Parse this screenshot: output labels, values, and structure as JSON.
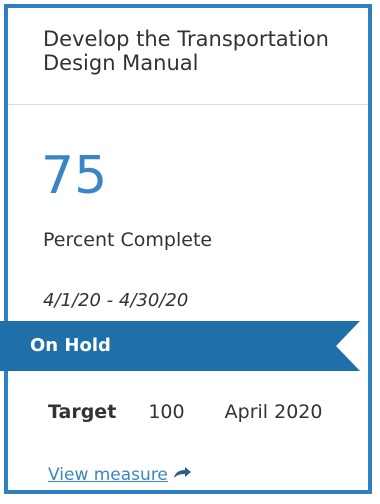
{
  "card": {
    "title": "Develop the Transportation Design Manual",
    "percent_value": "75",
    "percent_label": "Percent Complete",
    "date_range": "4/1/20 - 4/30/20",
    "status": "On Hold",
    "target": {
      "label": "Target",
      "value": "100",
      "date": "April 2020"
    },
    "link_label": "View measure",
    "link_icon": "share-arrow-icon"
  },
  "colors": {
    "border": "#2f80c0",
    "accent": "#3a86c4",
    "ribbon": "#1f6fa8"
  }
}
